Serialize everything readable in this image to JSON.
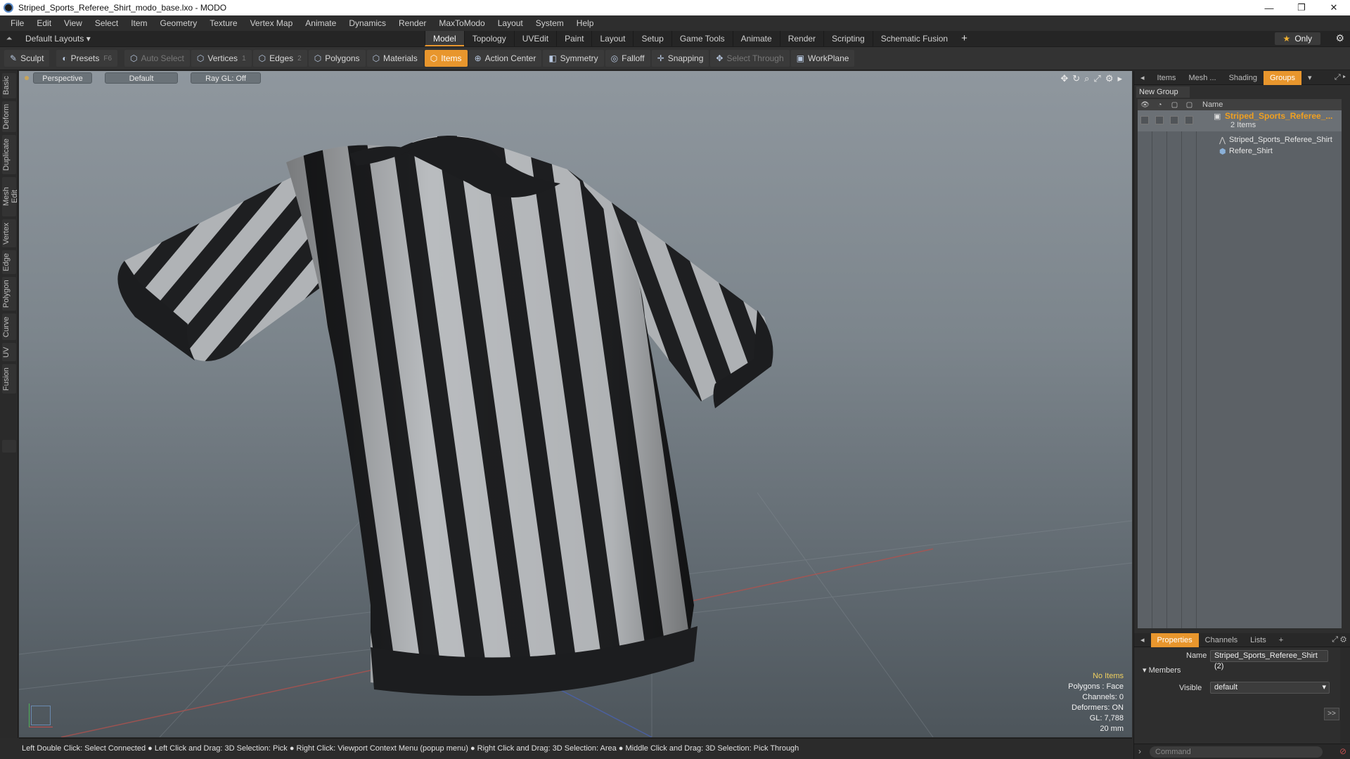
{
  "window": {
    "title": "Striped_Sports_Referee_Shirt_modo_base.lxo - MODO",
    "controls": [
      "—",
      "❐",
      "✕"
    ]
  },
  "menu": [
    "File",
    "Edit",
    "View",
    "Select",
    "Item",
    "Geometry",
    "Texture",
    "Vertex Map",
    "Animate",
    "Dynamics",
    "Render",
    "MaxToModo",
    "Layout",
    "System",
    "Help"
  ],
  "layoutbar": {
    "layouts_label": "Default Layouts ▾",
    "tabs": [
      "Model",
      "Topology",
      "UVEdit",
      "Paint",
      "Layout",
      "Setup",
      "Game Tools",
      "Animate",
      "Render",
      "Scripting",
      "Schematic Fusion"
    ],
    "active_tab": "Model",
    "add": "+",
    "only_label": "Only"
  },
  "toolbar": {
    "sculpt": "Sculpt",
    "presets": "Presets",
    "presets_key": "F6",
    "auto_select": "Auto Select",
    "vertices": "Vertices",
    "vertices_count": "1",
    "edges": "Edges",
    "edges_count": "2",
    "polygons": "Polygons",
    "materials": "Materials",
    "items": "Items",
    "action_center": "Action Center",
    "symmetry": "Symmetry",
    "falloff": "Falloff",
    "snapping": "Snapping",
    "select_through": "Select Through",
    "workplane": "WorkPlane"
  },
  "left_tabs": [
    "Basic",
    "Deform",
    "Duplicate",
    "Mesh Edit",
    "Vertex",
    "Edge",
    "Polygon",
    "Curve",
    "UV",
    "Fusion"
  ],
  "viewport": {
    "view": "Perspective",
    "shading": "Default",
    "raygl": "Ray GL: Off",
    "stats": {
      "selection": "No Items",
      "polygons": "Polygons : Face",
      "channels": "Channels: 0",
      "deformers": "Deformers: ON",
      "gl": "GL: 7,788",
      "scale": "20 mm"
    }
  },
  "statusbar": "Left Double Click: Select Connected ● Left Click and Drag: 3D Selection: Pick ● Right Click: Viewport Context Menu (popup menu) ● Right Click and Drag: 3D Selection: Area ● Middle Click and Drag: 3D Selection: Pick Through",
  "right_panel": {
    "tabs": [
      "Items",
      "Mesh ...",
      "Shading",
      "Groups"
    ],
    "active_tab": "Groups",
    "new_group": "New Group",
    "column_name": "Name",
    "group": {
      "name": "Striped_Sports_Referee_...",
      "count": "2 Items",
      "children": [
        "Striped_Sports_Referee_Shirt",
        "Refere_Shirt"
      ]
    },
    "properties_tabs": [
      "Properties",
      "Channels",
      "Lists",
      "+"
    ],
    "name_label": "Name",
    "name_value": "Striped_Sports_Referee_Shirt (2)",
    "members_label": "Members",
    "visible_label": "Visible",
    "visible_value": "default",
    "forward_button": ">>",
    "command_placeholder": "Command"
  },
  "colors": {
    "accent": "#e8962d",
    "group_name": "#f0a020",
    "stats_highlight": "#f0d060"
  }
}
